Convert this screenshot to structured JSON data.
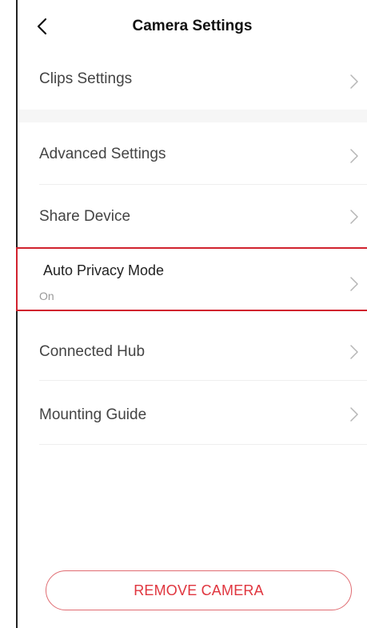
{
  "header": {
    "title": "Camera Settings",
    "back_icon": "chevron-left-icon"
  },
  "settings": {
    "clips": {
      "label": "Clips Settings"
    },
    "advanced": {
      "label": "Advanced Settings"
    },
    "share": {
      "label": "Share Device"
    },
    "privacy": {
      "label": "Auto Privacy Mode",
      "value": "On"
    },
    "hub": {
      "label": "Connected Hub"
    },
    "mounting": {
      "label": "Mounting Guide"
    }
  },
  "actions": {
    "remove_label": "REMOVE CAMERA"
  },
  "colors": {
    "accent": "#d1222e",
    "remove_text": "#e0353e",
    "remove_border": "#e06c72"
  }
}
